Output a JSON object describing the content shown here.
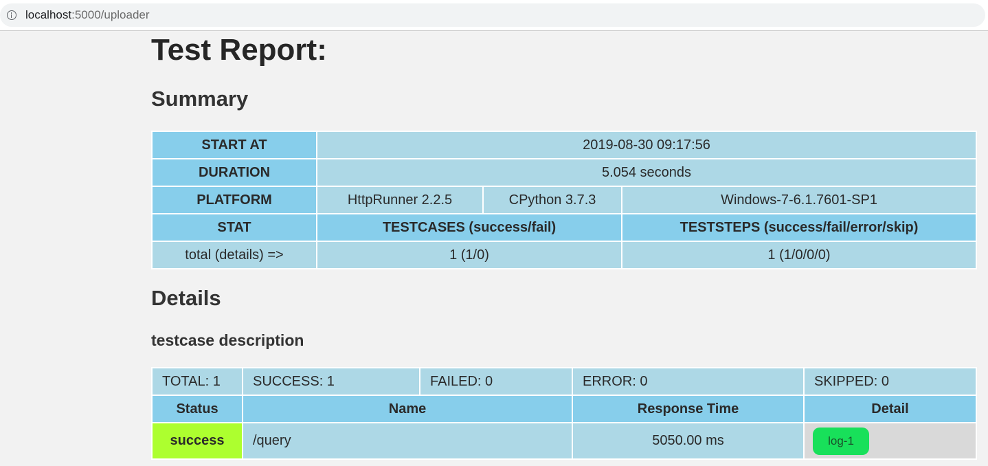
{
  "browser": {
    "url_host": "localhost",
    "url_path": ":5000/uploader"
  },
  "page": {
    "title": "Test Report:",
    "summary_heading": "Summary",
    "details_heading": "Details",
    "testcase_heading": "testcase description"
  },
  "summary": {
    "start_at_label": "START AT",
    "start_at_value": "2019-08-30 09:17:56",
    "duration_label": "DURATION",
    "duration_value": "5.054 seconds",
    "platform_label": "PLATFORM",
    "platform_runner": "HttpRunner 2.2.5",
    "platform_python": "CPython 3.7.3",
    "platform_os": "Windows-7-6.1.7601-SP1",
    "stat_label": "STAT",
    "testcases_header": "TESTCASES (success/fail)",
    "teststeps_header": "TESTSTEPS (success/fail/error/skip)",
    "total_label": "total (details) =>",
    "testcases_value": "1 (1/0)",
    "teststeps_value": "1 (1/0/0/0)"
  },
  "details": {
    "counts": {
      "total": "TOTAL: 1",
      "success": "SUCCESS: 1",
      "failed": "FAILED: 0",
      "error": "ERROR: 0",
      "skipped": "SKIPPED: 0"
    },
    "headers": {
      "status": "Status",
      "name": "Name",
      "response_time": "Response Time",
      "detail": "Detail"
    },
    "rows": [
      {
        "status": "success",
        "name": "/query",
        "response_time": "5050.00 ms",
        "detail_button": "log-1"
      }
    ]
  },
  "colors": {
    "header_bg": "#87ceeb",
    "cell_bg": "#add8e6",
    "success_bg": "#adff2f",
    "log_button_bg": "#18e05a"
  }
}
